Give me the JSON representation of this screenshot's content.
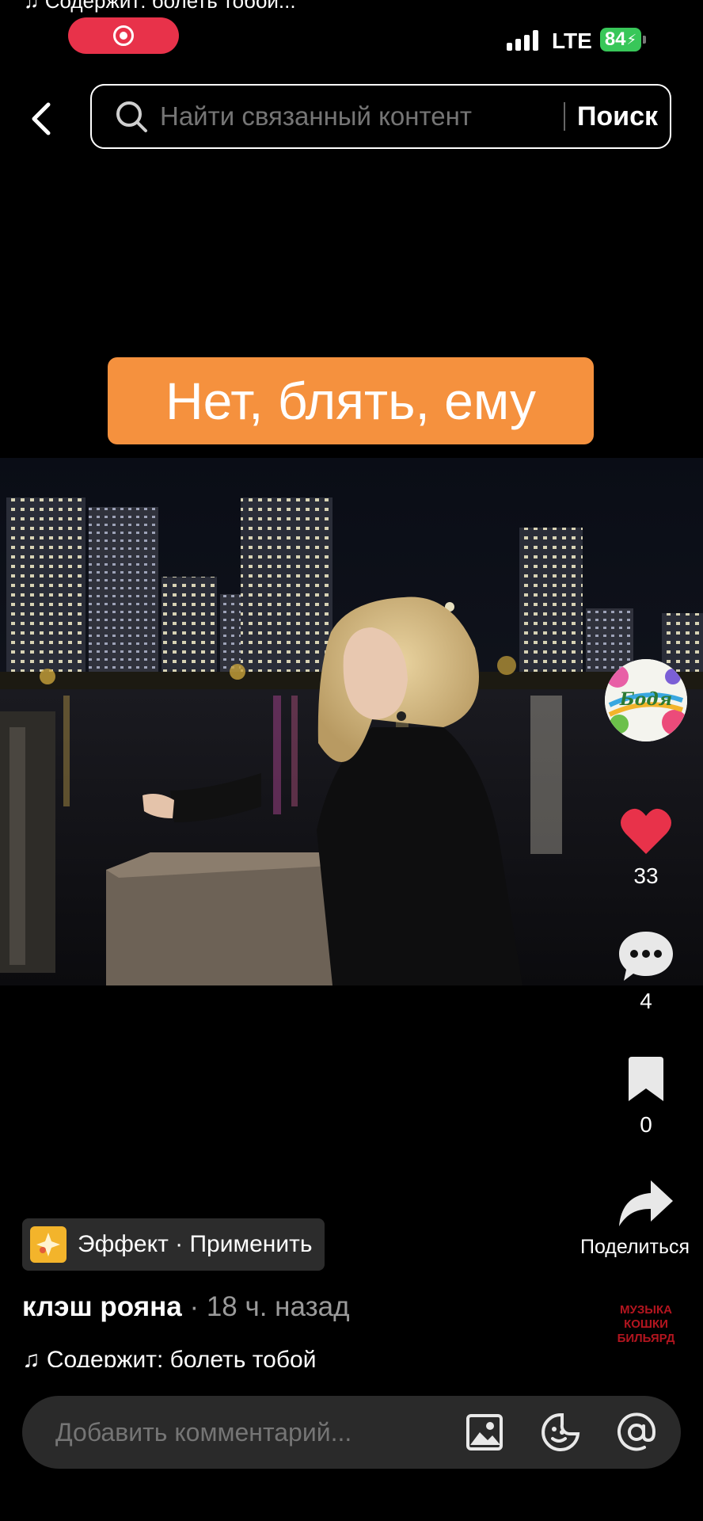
{
  "status_bar": {
    "ghost_text": "♫ Содержит: болеть тобой...",
    "network": "LTE",
    "battery": "84"
  },
  "search": {
    "placeholder": "Найти связанный контент",
    "button_label": "Поиск"
  },
  "video": {
    "caption": "Нет, блять, ему",
    "caption_color": "#f5913e"
  },
  "creator": {
    "avatar_text": "Бодя"
  },
  "actions": {
    "like_count": "33",
    "comment_count": "4",
    "bookmark_count": "0",
    "share_label": "Поделиться",
    "like_color": "#e8324a"
  },
  "post": {
    "effect_label": "Эффект · Применить",
    "author": "клэш рояна",
    "time": " · 18 ч. назад",
    "sound": "♫ Содержит: болеть тобой",
    "music_disc_text": [
      "МУЗЫКА",
      "КОШКИ",
      "БИЛЬЯРД"
    ]
  },
  "comment_bar": {
    "placeholder": "Добавить комментарий..."
  }
}
